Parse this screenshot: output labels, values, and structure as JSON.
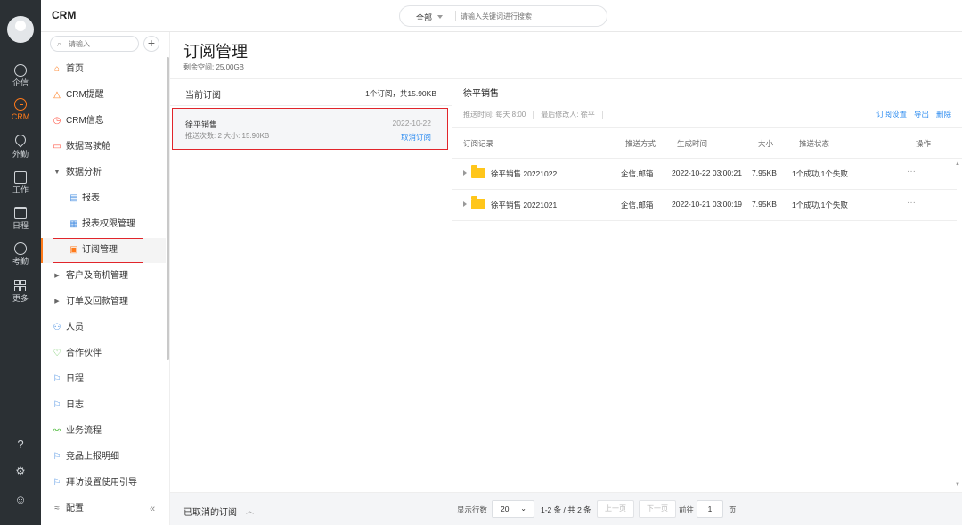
{
  "rail": {
    "items": [
      {
        "label": "企信",
        "icon": "chat-icon"
      },
      {
        "label": "CRM",
        "icon": "crm-clock-icon"
      },
      {
        "label": "外勤",
        "icon": "location-icon"
      },
      {
        "label": "工作",
        "icon": "work-icon"
      },
      {
        "label": "日程",
        "icon": "calendar-icon"
      },
      {
        "label": "考勤",
        "icon": "attendance-icon"
      },
      {
        "label": "更多",
        "icon": "grid-icon"
      }
    ],
    "bottom_icons": [
      "help-icon",
      "settings-icon",
      "people-icon"
    ],
    "active_color": "#ff7a1a"
  },
  "topbar": {
    "app_title": "CRM",
    "scope": "全部",
    "search_placeholder": "请输入关键词进行搜索"
  },
  "sidebar": {
    "search_placeholder": "请输入",
    "items": [
      {
        "label": "首页",
        "icon": "home-icon"
      },
      {
        "label": "CRM提醒",
        "icon": "bell-icon"
      },
      {
        "label": "CRM信息",
        "icon": "clock-icon"
      },
      {
        "label": "数据驾驶舱",
        "icon": "dashboard-icon"
      },
      {
        "label": "数据分析",
        "icon": "caret-down-icon"
      },
      {
        "label": "报表",
        "icon": "report-icon"
      },
      {
        "label": "报表权限管理",
        "icon": "report-permission-icon"
      },
      {
        "label": "订阅管理",
        "icon": "subscription-icon"
      },
      {
        "label": "客户及商机管理",
        "icon": "caret-right-icon"
      },
      {
        "label": "订单及回款管理",
        "icon": "caret-right-icon"
      },
      {
        "label": "人员",
        "icon": "people-icon"
      },
      {
        "label": "合作伙伴",
        "icon": "partner-icon"
      },
      {
        "label": "日程",
        "icon": "flag-icon"
      },
      {
        "label": "日志",
        "icon": "flag-icon"
      },
      {
        "label": "业务流程",
        "icon": "flow-icon"
      },
      {
        "label": "竞品上报明细",
        "icon": "flag-icon"
      },
      {
        "label": "拜访设置使用引导",
        "icon": "flag-icon"
      },
      {
        "label": "配置",
        "icon": "config-icon"
      }
    ]
  },
  "page": {
    "title": "订阅管理",
    "quota": "剩余空间: 25.00GB"
  },
  "list": {
    "title": "当前订阅",
    "count": "1个订阅，共15.90KB",
    "items": [
      {
        "name": "徐平销售",
        "meta": "推送次数: 2   大小: 15.90KB",
        "date": "2022-10-22",
        "cancel": "取消订阅"
      }
    ],
    "footer": "已取消的订阅"
  },
  "detail": {
    "title": "徐平销售",
    "push_time": "推送时间: 每天 8:00",
    "modifier": "最后修改人: 徐平",
    "actions": {
      "settings": "订阅设置",
      "export": "导出",
      "delete": "删除"
    },
    "columns": [
      "订阅记录",
      "推送方式",
      "生成时间",
      "大小",
      "推送状态",
      "操作"
    ],
    "rows": [
      {
        "name": "徐平销售 20221022",
        "method": "企信,邮箱",
        "time": "2022-10-22 03:00:21",
        "size": "7.95KB",
        "status": "1个成功,1个失败",
        "op": "···"
      },
      {
        "name": "徐平销售 20221021",
        "method": "企信,邮箱",
        "time": "2022-10-21 03:00:19",
        "size": "7.95KB",
        "status": "1个成功,1个失败",
        "op": "···"
      }
    ]
  },
  "pager": {
    "rows_label": "显示行数",
    "page_size": "20",
    "range": "1-2 条 / 共 2 条",
    "prev": "上一页",
    "next": "下一页",
    "goto": "前往",
    "page": "1",
    "page_unit": "页"
  }
}
